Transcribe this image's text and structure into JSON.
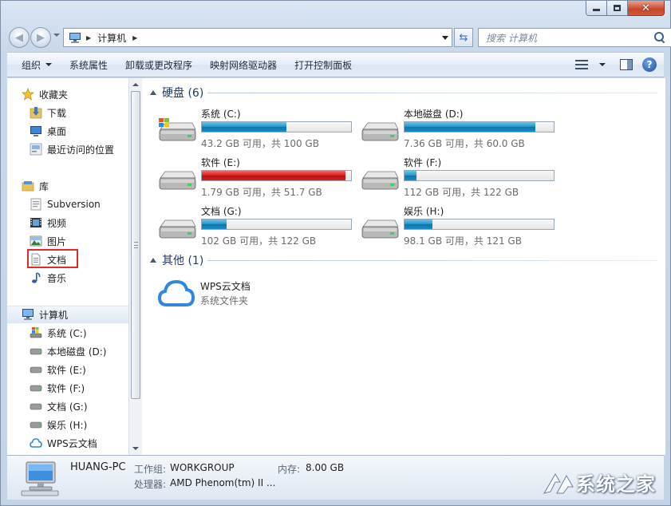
{
  "address": {
    "path_label": "计算机"
  },
  "search": {
    "placeholder": "搜索 计算机"
  },
  "toolbar": {
    "organize": "组织",
    "system_properties": "系统属性",
    "uninstall": "卸载或更改程序",
    "map_drive": "映射网络驱动器",
    "control_panel": "打开控制面板"
  },
  "navpane": {
    "favorites": "收藏夹",
    "downloads": "下载",
    "desktop": "桌面",
    "recent": "最近访问的位置",
    "libraries": "库",
    "subversion": "Subversion",
    "videos": "视频",
    "pictures": "图片",
    "documents": "文档",
    "music": "音乐",
    "computer": "计算机",
    "drives": [
      "系统 (C:)",
      "本地磁盘 (D:)",
      "软件 (E:)",
      "软件 (F:)",
      "文档 (G:)",
      "娱乐 (H:)"
    ],
    "wps": "WPS云文档"
  },
  "content": {
    "hdd_group": "硬盘 (6)",
    "other_group": "其他 (1)",
    "drives": [
      {
        "name": "系统 (C:)",
        "free": "43.2 GB 可用，共 100 GB",
        "used_pct": 56.8,
        "color": "blue"
      },
      {
        "name": "本地磁盘 (D:)",
        "free": "7.36 GB 可用，共 60.0 GB",
        "used_pct": 87.7,
        "color": "blue"
      },
      {
        "name": "软件 (E:)",
        "free": "1.79 GB 可用，共 51.7 GB",
        "used_pct": 96.5,
        "color": "red"
      },
      {
        "name": "软件 (F:)",
        "free": "112 GB 可用，共 122 GB",
        "used_pct": 8.2,
        "color": "blue"
      },
      {
        "name": "文档 (G:)",
        "free": "102 GB 可用，共 122 GB",
        "used_pct": 16.4,
        "color": "blue"
      },
      {
        "name": "娱乐 (H:)",
        "free": "98.1 GB 可用，共 121 GB",
        "used_pct": 18.9,
        "color": "blue"
      }
    ],
    "wps_name": "WPS云文档",
    "wps_type": "系统文件夹"
  },
  "details": {
    "pc_name": "HUANG-PC",
    "workgroup_label": "工作组:",
    "workgroup": "WORKGROUP",
    "memory_label": "内存:",
    "memory": "8.00 GB",
    "cpu_label": "处理器:",
    "cpu": "AMD Phenom(tm) II ..."
  },
  "watermark": {
    "text": "系统之家"
  },
  "colors": {
    "bar_blue": "#1a8dc4",
    "bar_red": "#d42424",
    "highlight": "#e02b2b",
    "group_title": "#1e3a6e"
  }
}
